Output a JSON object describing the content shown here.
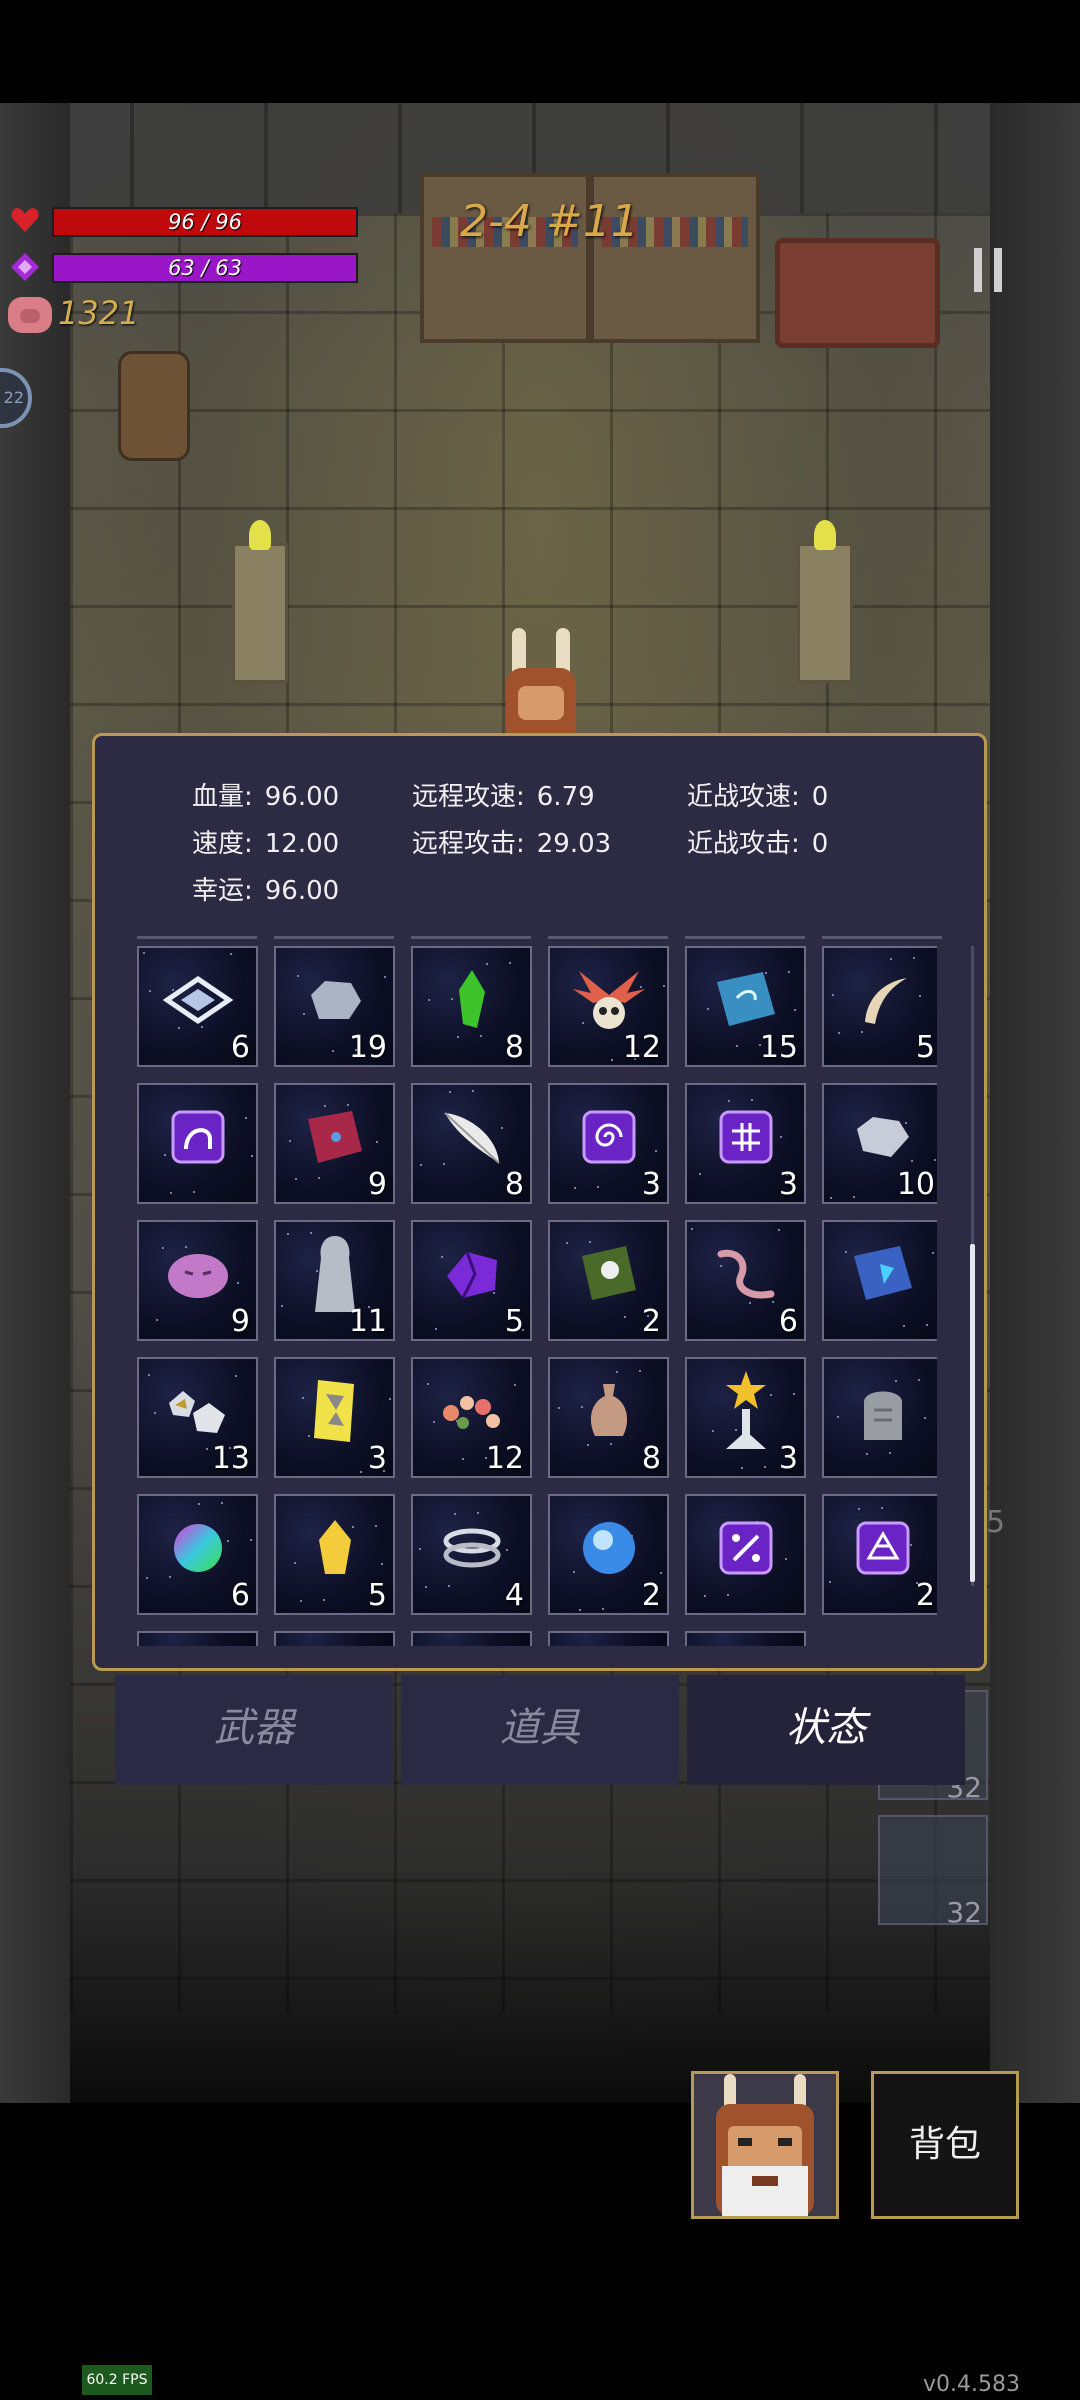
{
  "hud": {
    "hp_text": "96 / 96",
    "hp_fraction": 1.0,
    "mp_text": "63 / 63",
    "mp_fraction": 1.0,
    "coins": "1321",
    "level_label": "2-4 #11",
    "side_counter": "22"
  },
  "stats": {
    "items": [
      {
        "label": "血量:",
        "value": "96.00"
      },
      {
        "label": "远程攻速:",
        "value": "6.79"
      },
      {
        "label": "近战攻速:",
        "value": "0"
      },
      {
        "label": "速度:",
        "value": "12.00"
      },
      {
        "label": "远程攻击:",
        "value": "29.03"
      },
      {
        "label": "近战攻击:",
        "value": "0"
      },
      {
        "label": "幸运:",
        "value": "96.00"
      }
    ]
  },
  "inventory": {
    "scroll_fraction": 0.47,
    "items": [
      {
        "icon": "diamond-rune-icon",
        "count": "6"
      },
      {
        "icon": "grey-stone-icon",
        "count": "19"
      },
      {
        "icon": "green-crystal-icon",
        "count": "8"
      },
      {
        "icon": "feathered-skull-icon",
        "count": "12"
      },
      {
        "icon": "blue-spellbook-icon",
        "count": "15"
      },
      {
        "icon": "horn-icon",
        "count": "5"
      },
      {
        "icon": "purple-rune-curve-icon",
        "count": ""
      },
      {
        "icon": "red-book-icon",
        "count": "9"
      },
      {
        "icon": "white-feather-icon",
        "count": "8"
      },
      {
        "icon": "purple-rune-spiral-icon",
        "count": "3"
      },
      {
        "icon": "purple-rune-cross-icon",
        "count": "3"
      },
      {
        "icon": "silver-ore-icon",
        "count": "10"
      },
      {
        "icon": "pink-slime-icon",
        "count": "9"
      },
      {
        "icon": "hooded-statue-icon",
        "count": "11"
      },
      {
        "icon": "purple-gem-icon",
        "count": "5"
      },
      {
        "icon": "skull-tome-icon",
        "count": "2"
      },
      {
        "icon": "worm-icon",
        "count": "6"
      },
      {
        "icon": "crystal-tome-icon",
        "count": ""
      },
      {
        "icon": "ore-chunks-icon",
        "count": "13"
      },
      {
        "icon": "yellow-card-icon",
        "count": "3"
      },
      {
        "icon": "flower-wreath-icon",
        "count": "12"
      },
      {
        "icon": "sack-icon",
        "count": "8"
      },
      {
        "icon": "star-trophy-icon",
        "count": "3"
      },
      {
        "icon": "gravestone-icon",
        "count": ""
      },
      {
        "icon": "rainbow-orb-icon",
        "count": "6"
      },
      {
        "icon": "gold-crystal-icon",
        "count": "5"
      },
      {
        "icon": "silver-rings-icon",
        "count": "4"
      },
      {
        "icon": "blue-orb-icon",
        "count": "2"
      },
      {
        "icon": "purple-rune-percent-icon",
        "count": ""
      },
      {
        "icon": "purple-rune-triangle-icon",
        "count": "2"
      }
    ]
  },
  "tabs": [
    {
      "label": "武器",
      "active": false
    },
    {
      "label": "道具",
      "active": false
    },
    {
      "label": "状态",
      "active": true
    }
  ],
  "side_slots": [
    {
      "count": "32"
    },
    {
      "count": "32"
    }
  ],
  "side_number": "5",
  "bag_label": "背包",
  "fps": "60.2 FPS",
  "version": "v0.4.583",
  "colors": {
    "hp_fill": "#c0090c",
    "mp_fill": "#9a17c9",
    "panel_bg": "#2d2b44",
    "panel_border": "#b89a55",
    "coin_text": "#d4ad52"
  }
}
